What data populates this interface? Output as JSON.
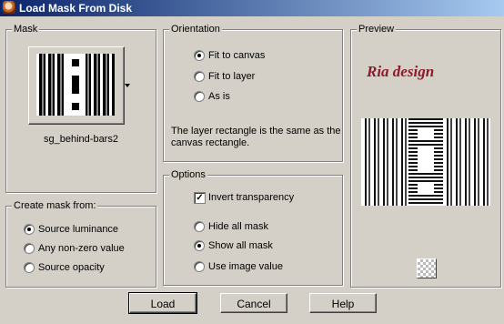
{
  "window": {
    "title": "Load Mask From Disk",
    "icon": "app-icon"
  },
  "mask": {
    "legend": "Mask",
    "name": "sg_behind-bars2"
  },
  "create_from": {
    "legend": "Create mask from:",
    "options": [
      {
        "label": "Source luminance",
        "checked": true
      },
      {
        "label": "Any non-zero value",
        "checked": false
      },
      {
        "label": "Source opacity",
        "checked": false
      }
    ]
  },
  "orientation": {
    "legend": "Orientation",
    "options": [
      {
        "label": "Fit to canvas",
        "checked": true
      },
      {
        "label": "Fit to layer",
        "checked": false
      },
      {
        "label": "As is",
        "checked": false
      }
    ],
    "note_line1": "The layer rectangle is the same as the",
    "note_line2": "canvas rectangle."
  },
  "options": {
    "legend": "Options",
    "invert": {
      "label": "Invert transparency",
      "checked": true
    },
    "radios": [
      {
        "label": "Hide all mask",
        "checked": false
      },
      {
        "label": "Show all mask",
        "checked": true
      },
      {
        "label": "Use image value",
        "checked": false
      }
    ]
  },
  "preview": {
    "legend": "Preview",
    "watermark": "Ria design"
  },
  "buttons": {
    "load": "Load",
    "cancel": "Cancel",
    "help": "Help"
  },
  "colors": {
    "title_start": "#0a246a",
    "title_end": "#a6caf0",
    "face": "#d4d0c8",
    "watermark": "#8b1a2b"
  }
}
